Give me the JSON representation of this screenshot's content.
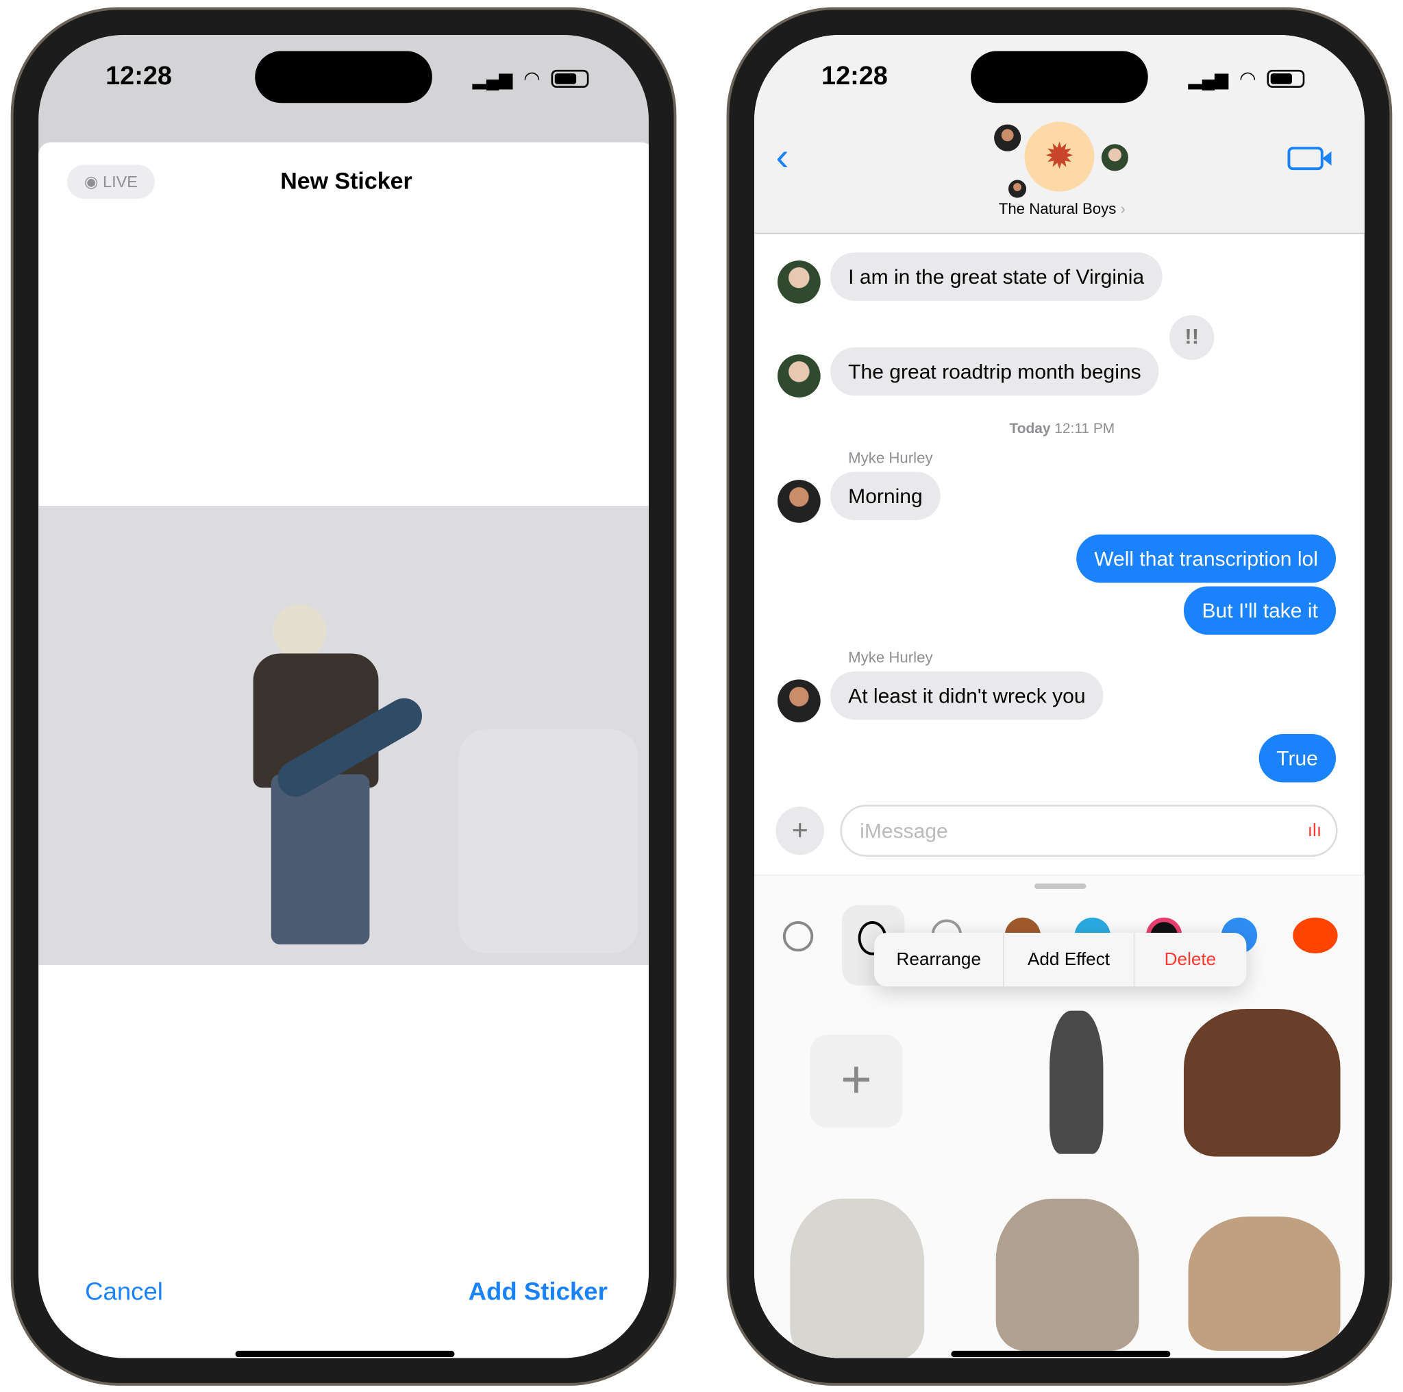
{
  "left": {
    "status": {
      "time": "12:28"
    },
    "live_badge": "LIVE",
    "title": "New Sticker",
    "cancel": "Cancel",
    "add_sticker": "Add Sticker"
  },
  "right": {
    "status": {
      "time": "12:28"
    },
    "group_name": "The Natural Boys",
    "messages": [
      {
        "from": "other",
        "text": "I am in the great state of Virginia"
      },
      {
        "from": "other",
        "text": "The great roadtrip month begins",
        "tapback": "!!"
      },
      {
        "timestamp_day": "Today",
        "timestamp_time": "12:11 PM"
      },
      {
        "from": "other",
        "sender": "Myke Hurley",
        "text": "Morning"
      },
      {
        "from": "me",
        "text": "Well that transcription lol"
      },
      {
        "from": "me",
        "text": "But I'll take it"
      },
      {
        "from": "other",
        "sender": "Myke Hurley",
        "text": "At least it didn't wreck you"
      },
      {
        "from": "me",
        "text": "True"
      }
    ],
    "input_placeholder": "iMessage",
    "menu": {
      "rearrange": "Rearrange",
      "add_effect": "Add Effect",
      "delete": "Delete"
    },
    "colors": {
      "accent": "#1a82fb",
      "delete": "#ff3b30",
      "bubble_gray": "#e9e9eb"
    }
  }
}
